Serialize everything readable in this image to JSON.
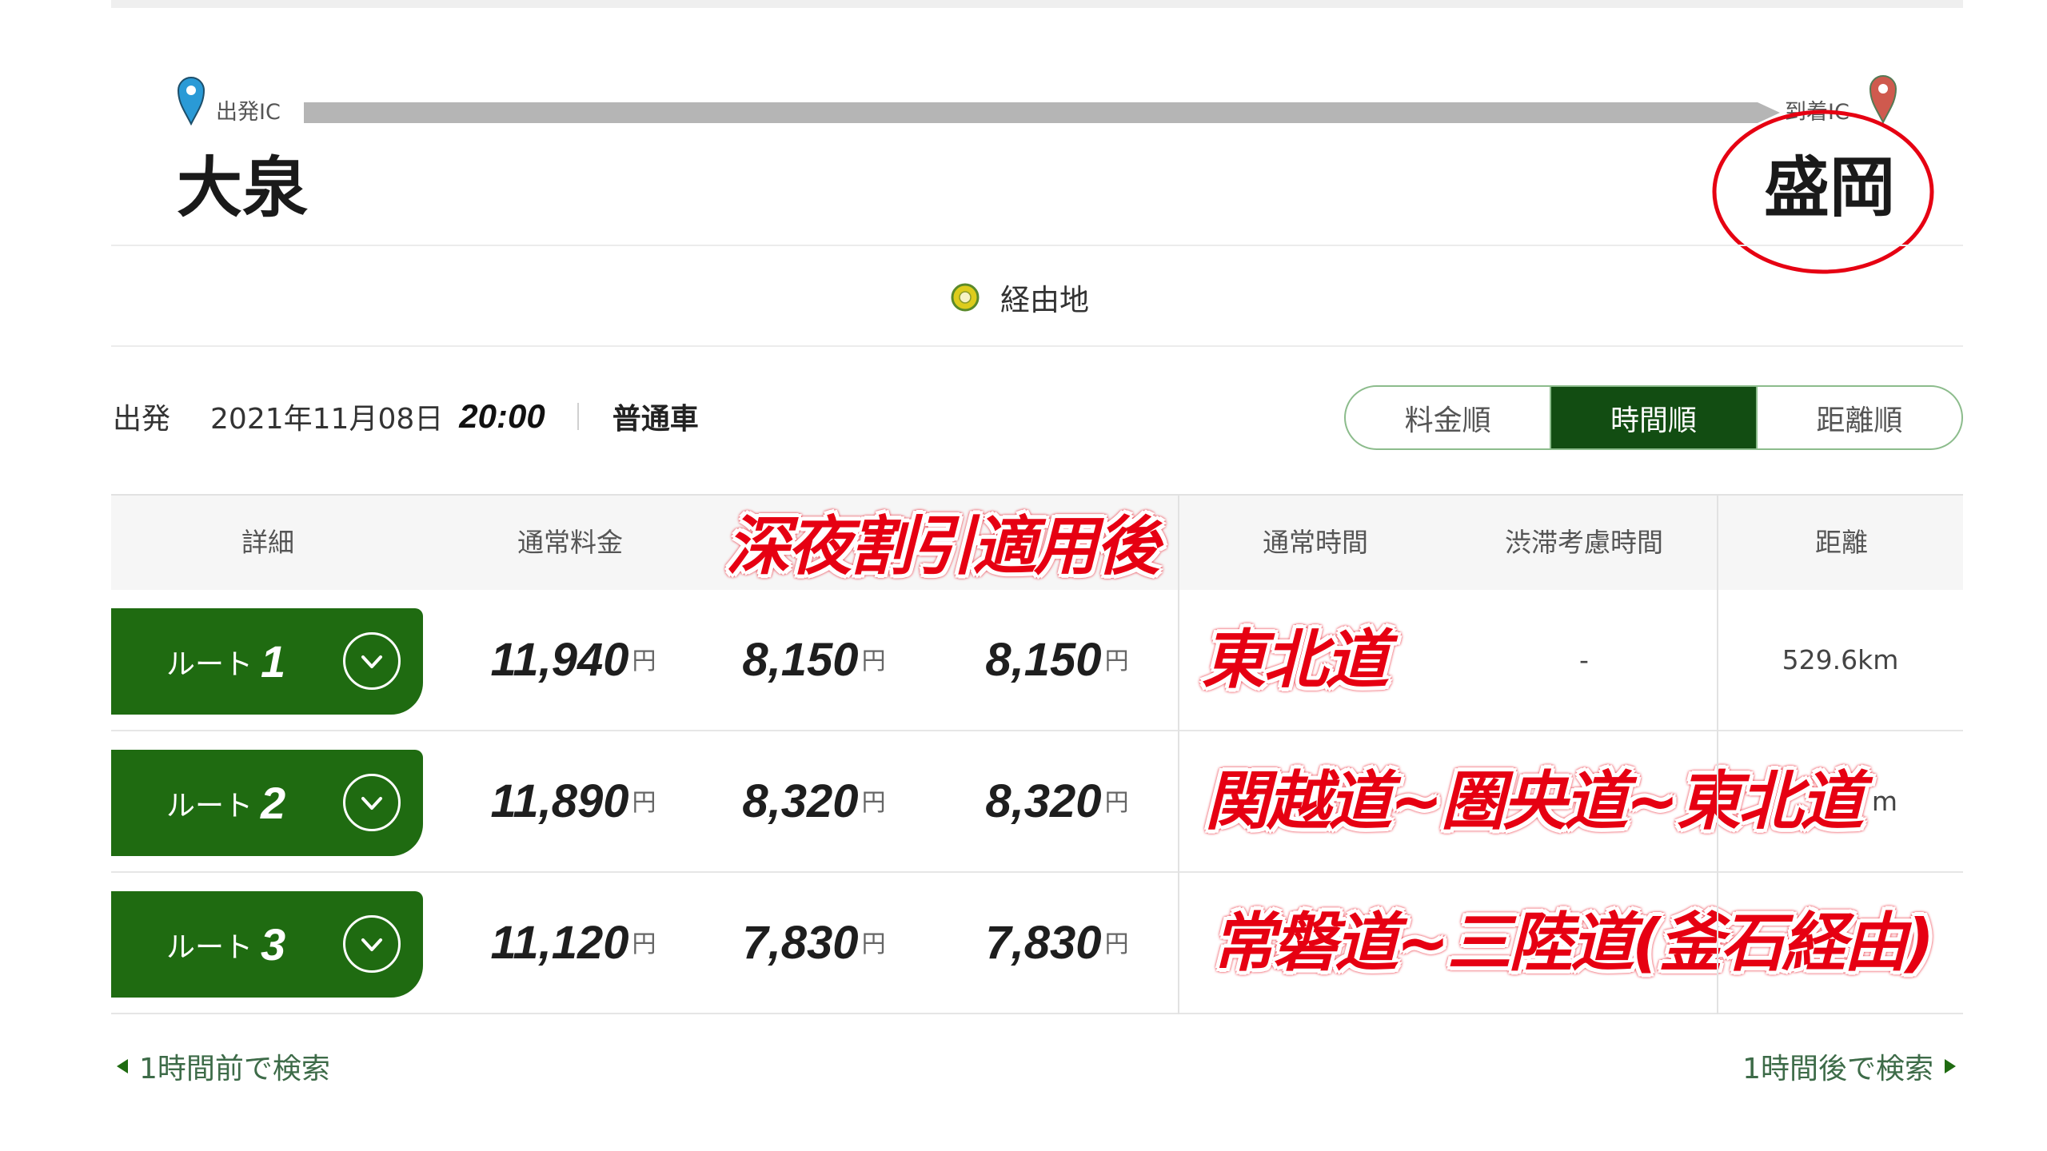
{
  "route_header": {
    "departure_label": "出発IC",
    "arrival_label": "到着IC",
    "departure_ic": "大泉",
    "arrival_ic": "盛岡"
  },
  "waypoint": {
    "label": "経由地"
  },
  "conditions": {
    "departure_label": "出発",
    "date": "2021年11月08日",
    "time": "20:00",
    "vehicle": "普通車"
  },
  "sort": {
    "options": [
      {
        "label": "料金順",
        "active": false
      },
      {
        "label": "時間順",
        "active": true
      },
      {
        "label": "距離順",
        "active": false
      }
    ]
  },
  "table": {
    "headers": {
      "detail": "詳細",
      "normal_fare": "通常料金",
      "normal_time": "通常時間",
      "congestion_time": "渋滞考慮時間",
      "distance": "距離"
    },
    "yen": "円",
    "routes": [
      {
        "label": "ルート",
        "number": "1",
        "normal_fare": "11,940",
        "fare_col2": "8,150",
        "fare_col3": "8,150",
        "congestion_time": "-",
        "distance": "529.6km"
      },
      {
        "label": "ルート",
        "number": "2",
        "normal_fare": "11,890",
        "fare_col2": "8,320",
        "fare_col3": "8,320",
        "distance_fragment": "m"
      },
      {
        "label": "ルート",
        "number": "3",
        "normal_fare": "11,120",
        "fare_col2": "7,830",
        "fare_col3": "7,830"
      }
    ]
  },
  "annotations": {
    "header_note": "深夜割引適用後",
    "route_names": [
      "東北道",
      "関越道~圏央道~東北道",
      "常磐道~三陸道(釜石経由)"
    ]
  },
  "pagination": {
    "prev": "1時間前で検索",
    "next": "1時間後で検索"
  },
  "colors": {
    "brand_green": "#1f6b11",
    "active_sort": "#124d12",
    "annotation_red": "#e60012",
    "start_pin": "#2a9ad6",
    "end_pin": "#cf5a4e"
  },
  "icons": {
    "departure": "map-pin-icon",
    "arrival": "map-pin-icon",
    "waypoint": "waypoint-ring-icon",
    "expand": "chevron-down-icon",
    "prev": "triangle-left-icon",
    "next": "triangle-right-icon"
  }
}
